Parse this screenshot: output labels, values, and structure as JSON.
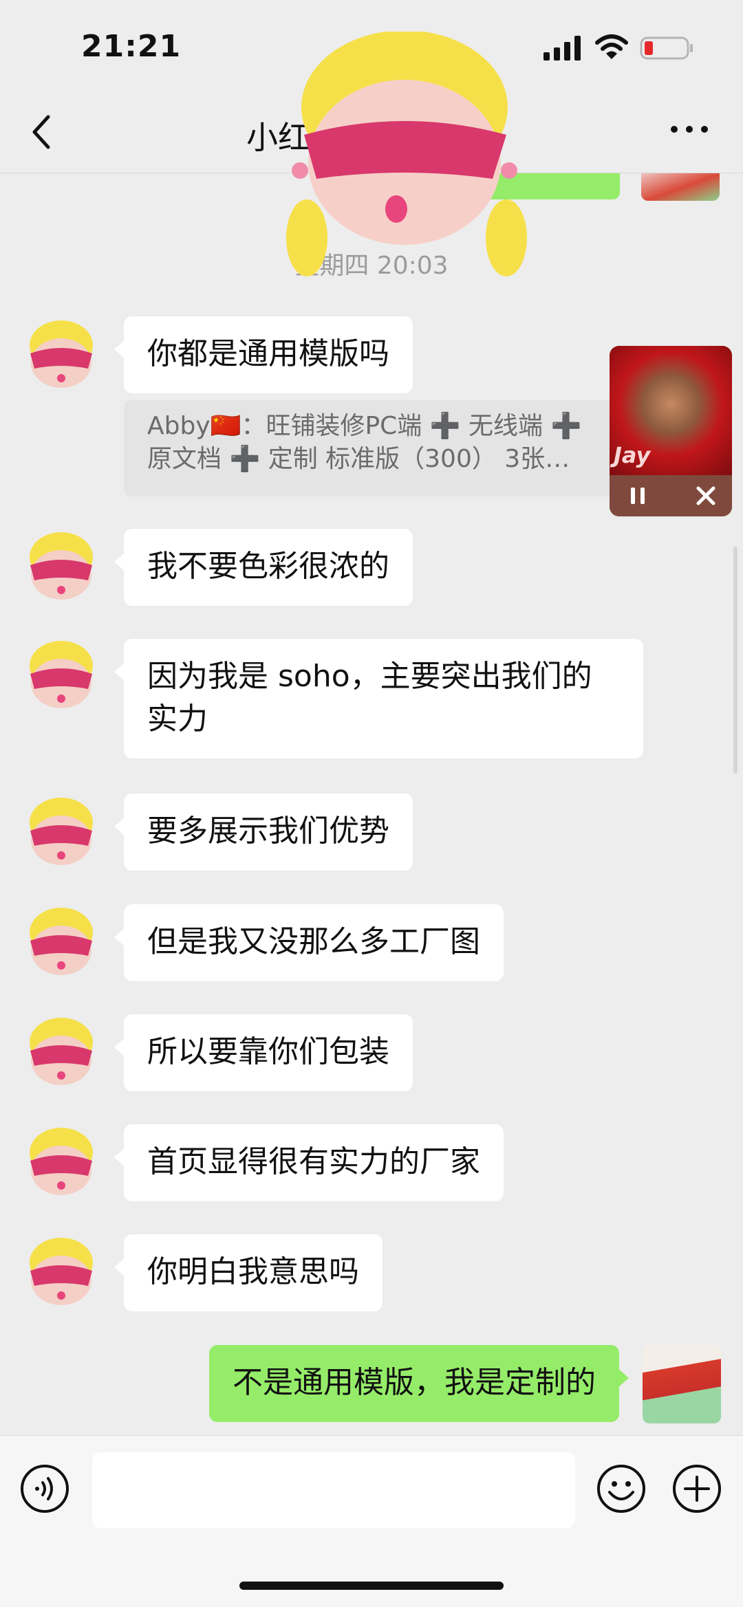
{
  "status": {
    "time": "21:21"
  },
  "nav": {
    "title": "小红"
  },
  "chat": {
    "timestamp": "星期四 20:03",
    "incoming": [
      {
        "text": "你都是通用模版吗"
      },
      {
        "text": "我不要色彩很浓的"
      },
      {
        "text": "因为我是 soho，主要突出我们的实力"
      },
      {
        "text": "要多展示我们优势"
      },
      {
        "text": "但是我又没那么多工厂图"
      },
      {
        "text": "所以要靠你们包装"
      },
      {
        "text": "首页显得很有实力的厂家"
      },
      {
        "text": "你明白我意思吗"
      }
    ],
    "quote": {
      "line1": "Abby🇨🇳：旺铺装修PC端 ➕ 无线端 ➕",
      "line2": "原文档 ➕ 定制  标准版（300） 3张…"
    },
    "outgoing": [
      {
        "text": "不是通用模版，我是定制的"
      }
    ]
  },
  "player": {
    "album_text": "Jay"
  },
  "colors": {
    "self_bubble": "#95ec69",
    "background": "#ededed",
    "player_bg": "#7f4a3d"
  },
  "icons": [
    "back-icon",
    "more-icon",
    "voice-icon",
    "emoji-icon",
    "plus-icon",
    "pause-icon",
    "close-icon",
    "signal-icon",
    "wifi-icon",
    "battery-icon"
  ]
}
